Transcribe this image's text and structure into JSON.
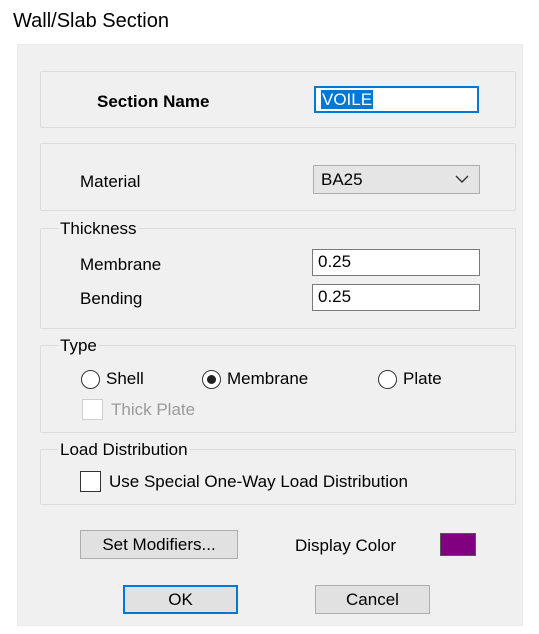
{
  "window": {
    "title": "Wall/Slab Section"
  },
  "section": {
    "label": "Section Name",
    "value": "VOILE"
  },
  "material": {
    "label": "Material",
    "selected": "BA25"
  },
  "thickness": {
    "group_label": "Thickness",
    "membrane_label": "Membrane",
    "membrane_value": "0.25",
    "bending_label": "Bending",
    "bending_value": "0.25"
  },
  "type": {
    "group_label": "Type",
    "options": [
      "Shell",
      "Membrane",
      "Plate"
    ],
    "selected": "Membrane",
    "thick_plate_label": "Thick Plate"
  },
  "load_distribution": {
    "group_label": "Load Distribution",
    "checkbox_label": "Use Special One-Way Load Distribution"
  },
  "modifiers": {
    "button_label": "Set Modifiers..."
  },
  "display_color": {
    "label": "Display Color",
    "color": "#800080"
  },
  "buttons": {
    "ok": "OK",
    "cancel": "Cancel"
  }
}
